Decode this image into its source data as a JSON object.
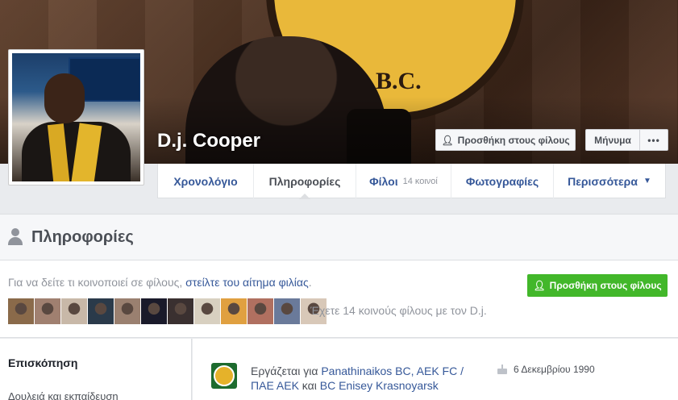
{
  "profile": {
    "name": "D.j. Cooper",
    "cover_crest_text": "B.C."
  },
  "cover_actions": {
    "add_friend": "Προσθήκη στους φίλους",
    "message": "Μήνυμα",
    "more": "•••"
  },
  "nav": {
    "timeline": "Χρονολόγιο",
    "about": "Πληροφορίες",
    "friends": "Φίλοι",
    "friends_mutual": "14 κοινοί",
    "photos": "Φωτογραφίες",
    "more": "Περισσότερα",
    "more_caret": "▼"
  },
  "section": {
    "title": "Πληροφορίες"
  },
  "friend_prompt": {
    "text_before": "Για να δείτε τι κοινοποιεί σε φίλους, ",
    "link": "στείλτε του αίτημα φιλίας",
    "text_after": ".",
    "add_button": "Προσθήκη στους φίλους",
    "mutual_text": "Έχετε 14 κοινούς φίλους με τον D.j.",
    "thumb_colors": [
      "#8a6a4a",
      "#a08070",
      "#c8b8a8",
      "#2a3a4a",
      "#9a8070",
      "#1a1a2a",
      "#3a3030",
      "#d8d0c0",
      "#e0a040",
      "#b07060",
      "#6a7a9a",
      "#d8c8b8"
    ]
  },
  "sidebar": {
    "overview": "Επισκόπηση",
    "work_education": "Δουλειά και εκπαίδευση"
  },
  "overview": {
    "work_prefix": "Εργάζεται για ",
    "work_links": "Panathinaikos BC, AEK FC / ΠΑΕ ΑΕΚ",
    "work_and": " και ",
    "work_last": "BC Enisey Krasnoyarsk",
    "birthday": "6 Δεκεμβρίου 1990"
  },
  "colors": {
    "link": "#365899",
    "green_button": "#42b72a",
    "page_bg": "#e9ebee"
  }
}
